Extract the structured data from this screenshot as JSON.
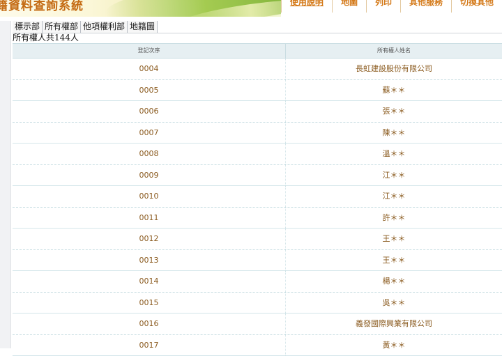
{
  "banner": {
    "title": "籍資料查詢系統"
  },
  "topnav": [
    "使用說明",
    "地圖",
    "列印",
    "其他服務",
    "切換其他"
  ],
  "tabs": [
    "標示部",
    "所有權部",
    "他項權利部",
    "地籍圖"
  ],
  "summary": "所有權人共144人",
  "table": {
    "headers": [
      "登記次序",
      "所有權人姓名"
    ],
    "rows": [
      {
        "order": "0004",
        "name": "長虹建設股份有限公司"
      },
      {
        "order": "0005",
        "name": "蘇＊＊"
      },
      {
        "order": "0006",
        "name": "張＊＊"
      },
      {
        "order": "0007",
        "name": "陳＊＊"
      },
      {
        "order": "0008",
        "name": "溫＊＊"
      },
      {
        "order": "0009",
        "name": "江＊＊"
      },
      {
        "order": "0010",
        "name": "江＊＊"
      },
      {
        "order": "0011",
        "name": "許＊＊"
      },
      {
        "order": "0012",
        "name": "王＊＊"
      },
      {
        "order": "0013",
        "name": "王＊＊"
      },
      {
        "order": "0014",
        "name": "楊＊＊"
      },
      {
        "order": "0015",
        "name": "吳＊＊"
      },
      {
        "order": "0016",
        "name": "義發國際興業有限公司"
      },
      {
        "order": "0017",
        "name": "黃＊＊"
      }
    ]
  }
}
